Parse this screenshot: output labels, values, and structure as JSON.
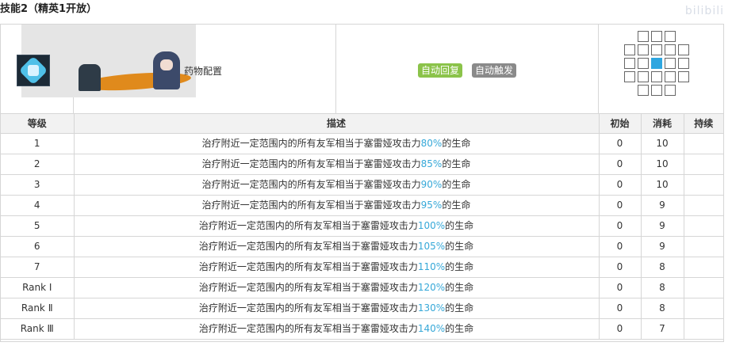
{
  "section_title": "技能2（精英1开放）",
  "watermark": "bilibili",
  "skill": {
    "name": "药物配置",
    "tags": [
      "自动回复",
      "自动触发"
    ],
    "tag_colors": {
      "recovery": "#8bc34a",
      "trigger": "#8a8a8a"
    },
    "icon": "medical-hex-icon",
    "range_self_color": "#2ea6e0"
  },
  "table": {
    "headers": [
      "等级",
      "描述",
      "初始",
      "消耗",
      "持续"
    ],
    "rows": [
      {
        "level": "1",
        "desc_prefix": "治疗附近一定范围内的所有友军相当于塞雷娅攻击力",
        "percent": "80%",
        "desc_suffix": "的生命",
        "initial": "0",
        "cost": "10",
        "duration": ""
      },
      {
        "level": "2",
        "desc_prefix": "治疗附近一定范围内的所有友军相当于塞雷娅攻击力",
        "percent": "85%",
        "desc_suffix": "的生命",
        "initial": "0",
        "cost": "10",
        "duration": ""
      },
      {
        "level": "3",
        "desc_prefix": "治疗附近一定范围内的所有友军相当于塞雷娅攻击力",
        "percent": "90%",
        "desc_suffix": "的生命",
        "initial": "0",
        "cost": "10",
        "duration": ""
      },
      {
        "level": "4",
        "desc_prefix": "治疗附近一定范围内的所有友军相当于塞雷娅攻击力",
        "percent": "95%",
        "desc_suffix": "的生命",
        "initial": "0",
        "cost": "9",
        "duration": ""
      },
      {
        "level": "5",
        "desc_prefix": "治疗附近一定范围内的所有友军相当于塞雷娅攻击力",
        "percent": "100%",
        "desc_suffix": "的生命",
        "initial": "0",
        "cost": "9",
        "duration": ""
      },
      {
        "level": "6",
        "desc_prefix": "治疗附近一定范围内的所有友军相当于塞雷娅攻击力",
        "percent": "105%",
        "desc_suffix": "的生命",
        "initial": "0",
        "cost": "9",
        "duration": ""
      },
      {
        "level": "7",
        "desc_prefix": "治疗附近一定范围内的所有友军相当于塞雷娅攻击力",
        "percent": "110%",
        "desc_suffix": "的生命",
        "initial": "0",
        "cost": "8",
        "duration": ""
      },
      {
        "level": "Rank Ⅰ",
        "desc_prefix": "治疗附近一定范围内的所有友军相当于塞雷娅攻击力",
        "percent": "120%",
        "desc_suffix": "的生命",
        "initial": "0",
        "cost": "8",
        "duration": ""
      },
      {
        "level": "Rank Ⅱ",
        "desc_prefix": "治疗附近一定范围内的所有友军相当于塞雷娅攻击力",
        "percent": "130%",
        "desc_suffix": "的生命",
        "initial": "0",
        "cost": "8",
        "duration": ""
      },
      {
        "level": "Rank Ⅲ",
        "desc_prefix": "治疗附近一定范围内的所有友军相当于塞雷娅攻击力",
        "percent": "140%",
        "desc_suffix": "的生命",
        "initial": "0",
        "cost": "7",
        "duration": ""
      }
    ]
  }
}
